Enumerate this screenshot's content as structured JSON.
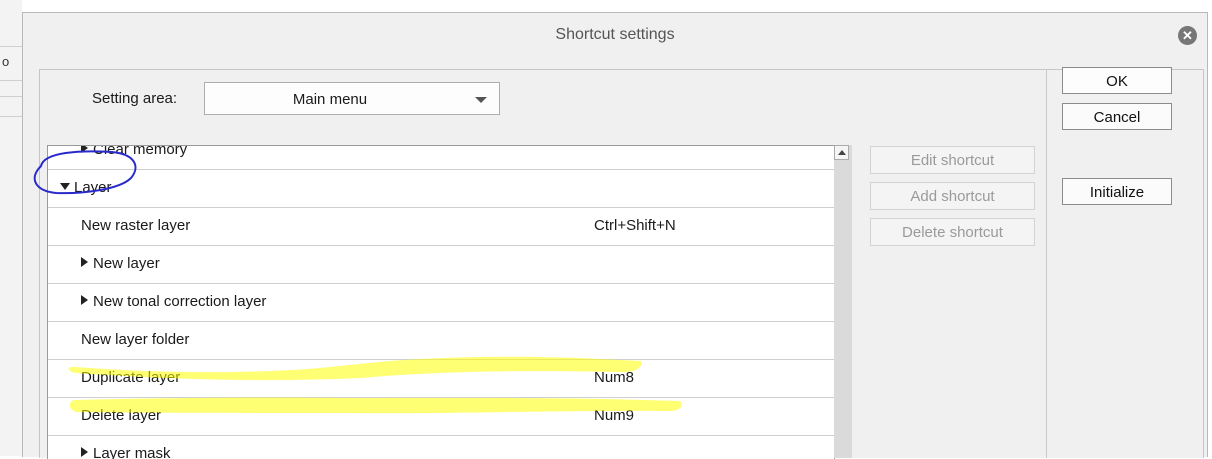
{
  "background": {
    "fragment": "o"
  },
  "dialog": {
    "title": "Shortcut settings"
  },
  "setting_area": {
    "label": "Setting area:",
    "selected": "Main menu"
  },
  "list": {
    "items": [
      {
        "label": "Clear memory",
        "shortcut": "",
        "kind": "collapsed"
      },
      {
        "label": "Layer",
        "shortcut": "",
        "kind": "expanded"
      },
      {
        "label": "New raster layer",
        "shortcut": "Ctrl+Shift+N",
        "kind": "item"
      },
      {
        "label": "New layer",
        "shortcut": "",
        "kind": "collapsed"
      },
      {
        "label": "New tonal correction layer",
        "shortcut": "",
        "kind": "collapsed"
      },
      {
        "label": "New layer folder",
        "shortcut": "",
        "kind": "item"
      },
      {
        "label": "Duplicate layer",
        "shortcut": "Num8",
        "kind": "item"
      },
      {
        "label": "Delete layer",
        "shortcut": "Num9",
        "kind": "item"
      },
      {
        "label": "Layer mask",
        "shortcut": "",
        "kind": "collapsed"
      }
    ]
  },
  "buttons": {
    "edit_shortcut": "Edit shortcut",
    "add_shortcut": "Add shortcut",
    "delete_shortcut": "Delete shortcut",
    "ok": "OK",
    "cancel": "Cancel",
    "initialize": "Initialize"
  },
  "colors": {
    "highlight": "#ffff00",
    "annotation_circle": "#2a2acb"
  }
}
